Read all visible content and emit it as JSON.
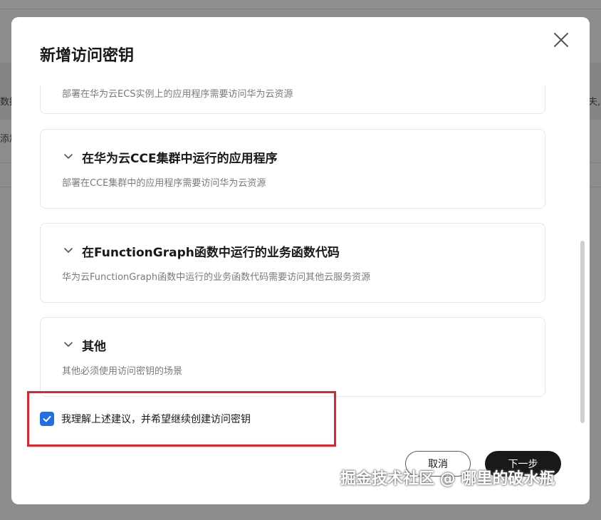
{
  "background": {
    "left_fragment_1": "数据",
    "left_fragment_2": "添加",
    "right_fragment": "夫,"
  },
  "dialog": {
    "title": "新增访问密钥",
    "scenarios": [
      {
        "title": "",
        "description": "部署在华为云ECS实例上的应用程序需要访问华为云资源"
      },
      {
        "title": "在华为云CCE集群中运行的应用程序",
        "description": "部署在CCE集群中的应用程序需要访问华为云资源"
      },
      {
        "title": "在FunctionGraph函数中运行的业务函数代码",
        "description": "华为云FunctionGraph函数中运行的业务函数代码需要访问其他云服务资源"
      },
      {
        "title": "其他",
        "description": "其他必须使用访问密钥的场景"
      }
    ],
    "confirm_label": "我理解上述建议，并希望继续创建访问密钥",
    "confirm_checked": true,
    "cancel_label": "取消",
    "next_label": "下一步"
  },
  "watermark": "掘金技术社区 @ 哪里的破水瓶",
  "colors": {
    "accent": "#1f6fe5",
    "primary_button": "#191919",
    "highlight": "#e2252d"
  },
  "icons": {
    "close": "close-icon",
    "expand": "chevron-down-icon",
    "check": "check-icon"
  }
}
